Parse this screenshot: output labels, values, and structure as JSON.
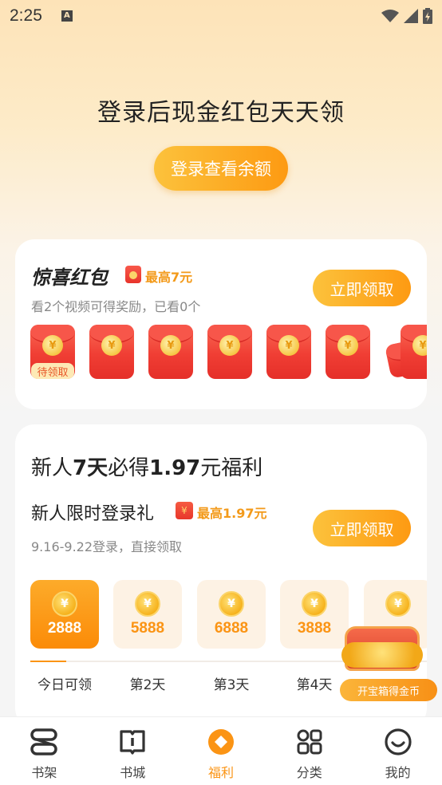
{
  "status_bar": {
    "time": "2:25",
    "notification_icon": "A"
  },
  "hero": {
    "title": "登录后现金红包天天领",
    "login_button": "登录查看余额"
  },
  "surprise_card": {
    "title": "惊喜红包",
    "max_amount": "最高7元",
    "subtitle": "看2个视频可得奖励，已看0个",
    "claim_button": "立即领取",
    "pending_tag": "待领取",
    "envelope_count": 7
  },
  "newbie_card": {
    "title_parts": [
      "新人",
      "7天",
      "必得",
      "1.97",
      "元福利"
    ],
    "gift_title": "新人限时登录礼",
    "max_amount": "最高1.97元",
    "date_text": "9.16-9.22登录，直接领取",
    "claim_button": "立即领取",
    "days": [
      {
        "value": "2888",
        "label": "今日可领",
        "active": true
      },
      {
        "value": "5888",
        "label": "第2天",
        "active": false
      },
      {
        "value": "6888",
        "label": "第3天",
        "active": false
      },
      {
        "value": "3888",
        "label": "第4天",
        "active": false
      },
      {
        "value": "",
        "label": "",
        "active": false
      }
    ],
    "progress_fraction": 0.09
  },
  "treasure": {
    "label": "开宝箱得金币"
  },
  "nav": [
    {
      "label": "书架",
      "icon": "bookshelf-icon",
      "active": false
    },
    {
      "label": "书城",
      "icon": "book-store-icon",
      "active": false
    },
    {
      "label": "福利",
      "icon": "welfare-icon",
      "active": true
    },
    {
      "label": "分类",
      "icon": "category-grid-icon",
      "active": false
    },
    {
      "label": "我的",
      "icon": "profile-icon",
      "active": false
    }
  ],
  "colors": {
    "accent": "#fb9414",
    "envelope_red": "#f03e34",
    "text": "#222222"
  }
}
